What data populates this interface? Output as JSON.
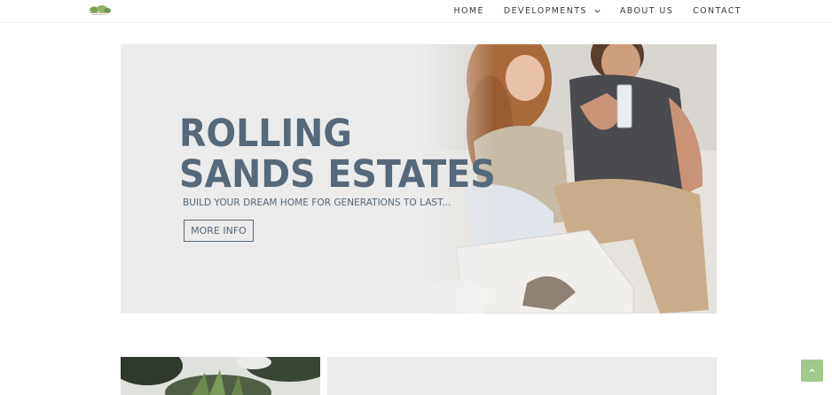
{
  "nav": {
    "items": [
      {
        "label": "HOME"
      },
      {
        "label": "DEVELOPMENTS",
        "has_dropdown": true
      },
      {
        "label": "ABOUT US"
      },
      {
        "label": "CONTACT"
      }
    ]
  },
  "hero": {
    "title_line1": "ROLLING",
    "title_line2": "SANDS ESTATES",
    "subtitle": "BUILD YOUR DREAM HOME FOR GENERATIONS TO LAST...",
    "button_label": "MORE INFO",
    "text_color": "#56697a",
    "background_color": "#ebebeb"
  },
  "icons": {
    "logo": "logo-icon",
    "dropdown": "chevron-down-icon",
    "back_to_top": "chevron-up-icon"
  },
  "colors": {
    "accent_green": "#9ec98a",
    "nav_text": "#3a3a3a"
  }
}
